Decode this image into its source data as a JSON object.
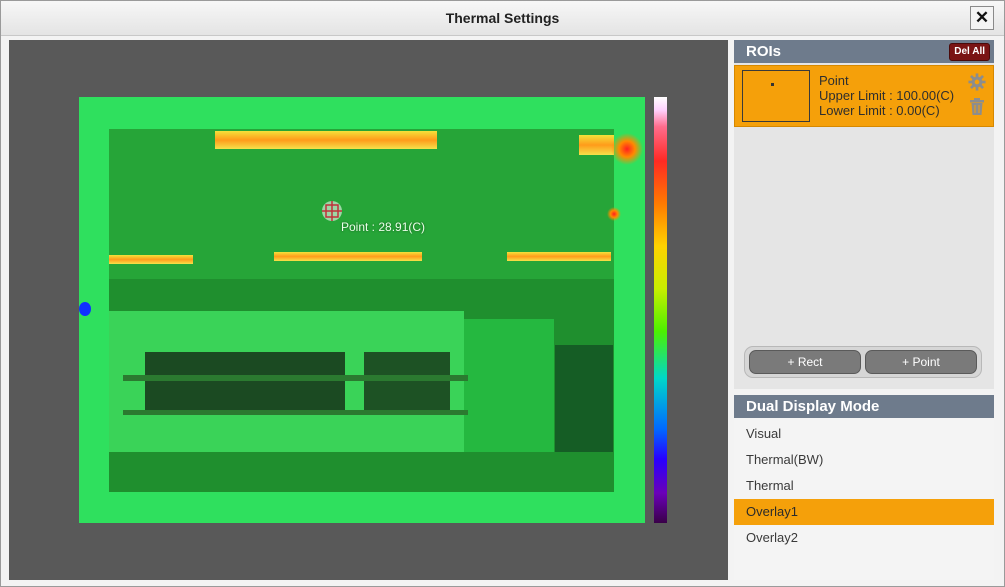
{
  "window": {
    "title": "Thermal Settings",
    "close_label": "✕"
  },
  "viewer": {
    "point_label": "Point : 28.91(C)"
  },
  "rois": {
    "header": "ROIs",
    "del_all_label": "Del All",
    "items": [
      {
        "name": "Point",
        "upper": "Upper Limit : 100.00(C)",
        "lower": "Lower Limit : 0.00(C)"
      }
    ],
    "add_rect_label": "+ Rect",
    "add_point_label": "+ Point"
  },
  "dual_display": {
    "header": "Dual Display Mode",
    "options": [
      "Visual",
      "Thermal(BW)",
      "Thermal",
      "Overlay1",
      "Overlay2"
    ],
    "selected": "Overlay1"
  },
  "colors": {
    "accent": "#f5a00a",
    "header": "#6e7b8c",
    "viewer_bg": "#595959"
  }
}
